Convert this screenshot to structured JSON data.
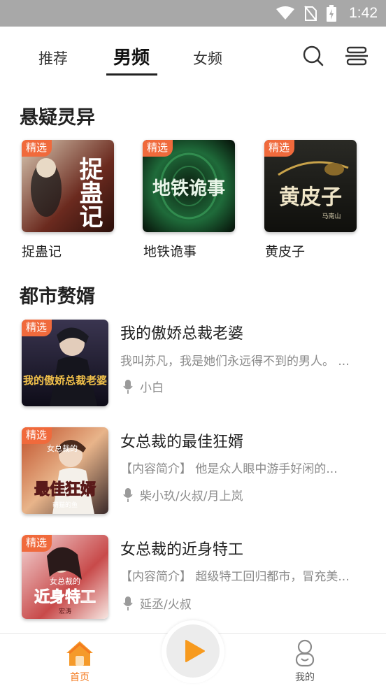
{
  "status_bar": {
    "time": "1:42"
  },
  "top_nav": {
    "tabs": [
      {
        "label": "推荐",
        "active": false
      },
      {
        "label": "男频",
        "active": true
      },
      {
        "label": "女频",
        "active": false
      }
    ],
    "icons": [
      "search-icon",
      "menu-layers-icon"
    ]
  },
  "badge_label": "精选",
  "section1": {
    "title": "悬疑灵异",
    "books": [
      {
        "title": "捉蛊记"
      },
      {
        "title": "地铁诡事"
      },
      {
        "title": "黄皮子"
      }
    ]
  },
  "section2": {
    "title": "都市赘婿",
    "books": [
      {
        "title": "我的傲娇总裁老婆",
        "desc": "我叫苏凡，我是她们永远得不到的男人。 ...",
        "narrator": "小白"
      },
      {
        "title": "女总裁的最佳狂婿",
        "desc": "【内容简介】 他是众人眼中游手好闲的...",
        "narrator": "柴小玖/火叔/月上岚"
      },
      {
        "title": "女总裁的近身特工",
        "desc": "【内容简介】 超级特工回归都市，冒充美...",
        "narrator": "延丞/火叔"
      }
    ]
  },
  "cover_text": {
    "b1": "捉蛊记",
    "b2": "地铁诡事",
    "b3": "黄皮子",
    "b3_author": "马南山",
    "l1": "我的傲娇总裁老婆",
    "l2": "最佳狂婿",
    "l2_top": "女总裁的",
    "l2_author": "萌猫的鱼",
    "l3": "近身特工",
    "l3_top": "女总裁的",
    "l3_author": "宏涛"
  },
  "bottom_nav": {
    "home_label": "首页",
    "mine_label": "我的"
  },
  "colors": {
    "accent": "#f47a1f",
    "badge": "#f06a3c",
    "status_bar": "#a8a8a8"
  }
}
